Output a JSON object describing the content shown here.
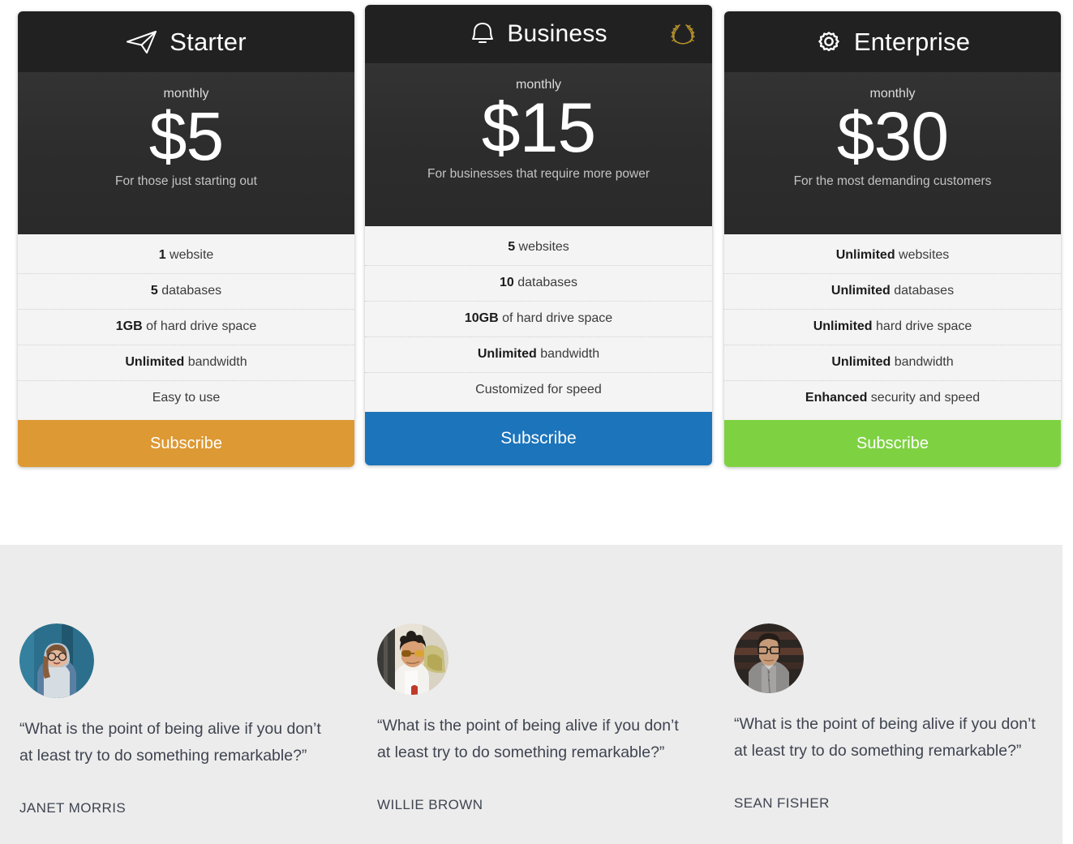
{
  "pricing": {
    "plans": [
      {
        "id": "starter",
        "icon": "paper-plane-icon",
        "title": "Starter",
        "period": "monthly",
        "price": "$5",
        "description": "For those just starting out",
        "badge": null,
        "features": [
          {
            "strong": "1",
            "rest": " website"
          },
          {
            "strong": "5",
            "rest": " databases"
          },
          {
            "strong": "1GB",
            "rest": " of hard drive space"
          },
          {
            "strong": "Unlimited",
            "rest": " bandwidth"
          },
          {
            "strong": "",
            "rest": "Easy to use"
          }
        ],
        "cta": "Subscribe",
        "accent": "#dd9933"
      },
      {
        "id": "business",
        "icon": "bell-icon",
        "title": "Business",
        "period": "monthly",
        "price": "$15",
        "description": "For businesses that require more power",
        "badge": "laurel-wreath-icon",
        "badge_color": "#b5912a",
        "features": [
          {
            "strong": "5",
            "rest": " websites"
          },
          {
            "strong": "10",
            "rest": " databases"
          },
          {
            "strong": "10GB",
            "rest": " of hard drive space"
          },
          {
            "strong": "Unlimited",
            "rest": " bandwidth"
          },
          {
            "strong": "",
            "rest": "Customized for speed"
          }
        ],
        "cta": "Subscribe",
        "accent": "#1c74bb"
      },
      {
        "id": "enterprise",
        "icon": "gear-icon",
        "title": "Enterprise",
        "period": "monthly",
        "price": "$30",
        "description": "For the most demanding customers",
        "badge": null,
        "features": [
          {
            "strong": "Unlimited",
            "rest": " websites"
          },
          {
            "strong": "Unlimited",
            "rest": " databases"
          },
          {
            "strong": "Unlimited",
            "rest": " hard drive space"
          },
          {
            "strong": "Unlimited",
            "rest": " bandwidth"
          },
          {
            "strong": "Enhanced",
            "rest": " security and speed"
          }
        ],
        "cta": "Subscribe",
        "accent": "#7ed242"
      }
    ]
  },
  "testimonials": {
    "background": "#ececec",
    "items": [
      {
        "avatar": "avatar-photo-woman-hoodie",
        "quote": "“What is the point of being alive if you don’t at least try to do something remarkable?”",
        "author": "JANET MORRIS"
      },
      {
        "avatar": "avatar-photo-man-sunglasses",
        "quote": "“What is the point of being alive if you don’t at least try to do something remarkable?”",
        "author": "WILLIE BROWN"
      },
      {
        "avatar": "avatar-photo-man-glasses",
        "quote": "“What is the point of being alive if you don’t at least try to do something remarkable?”",
        "author": "SEAN FISHER"
      }
    ]
  }
}
